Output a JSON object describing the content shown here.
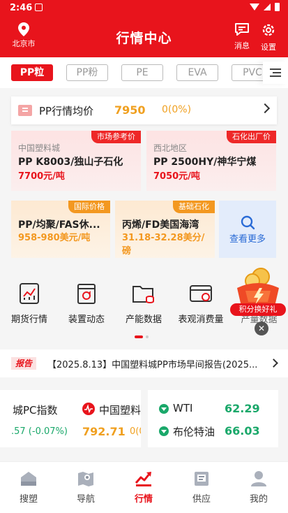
{
  "status_bar": {
    "time": "2:46"
  },
  "header": {
    "location": "北京市",
    "title": "行情中心",
    "message_label": "消息",
    "settings_label": "设置"
  },
  "tabs": [
    "PP粒",
    "PP粉",
    "PE",
    "EVA",
    "PVC"
  ],
  "active_tab": "PP粒",
  "average": {
    "title": "PP行情均价",
    "price": "7950",
    "change": "0(0%)"
  },
  "cards_top": [
    {
      "tag": "市场参考价",
      "source": "中国塑料城",
      "name": "PP K8003/独山子石化",
      "price": "7700元/吨"
    },
    {
      "tag": "石化出厂价",
      "source": "西北地区",
      "name": "PP 2500HY/神华宁煤",
      "price": "7050元/吨"
    }
  ],
  "cards_bottom": [
    {
      "tag": "国际价格",
      "name": "PP/均聚/FAS休...",
      "price": "958-980美元/吨"
    },
    {
      "tag": "基础石化",
      "name": "丙烯/FD美国海湾",
      "price_line1": "31.18-32.28美分/",
      "price_line2": "磅"
    }
  ],
  "view_more": "查看更多",
  "entries": [
    "期货行情",
    "装置动态",
    "产能数据",
    "表观消费量",
    "产量数据"
  ],
  "promo": {
    "label": "积分换好礼"
  },
  "report": {
    "badge": "报告",
    "text": "【2025.8.13】中国塑料城PP市场早间报告(2025..."
  },
  "index_left": {
    "name1": "城PC指数",
    "change1": ".57 (-0.07%)",
    "name2": "中国塑料",
    "value2": "792.71",
    "change2": "0(0"
  },
  "index_right": [
    {
      "name": "WTI",
      "value": "62.29"
    },
    {
      "name": "布伦特油",
      "value": "66.03"
    }
  ],
  "bottom_nav": [
    {
      "label": "搜塑",
      "icon": "home-icon"
    },
    {
      "label": "导航",
      "icon": "map-icon"
    },
    {
      "label": "行情",
      "icon": "chart-icon"
    },
    {
      "label": "供应",
      "icon": "supply-icon"
    },
    {
      "label": "我的",
      "icon": "user-icon"
    }
  ],
  "active_nav": "行情",
  "colors": {
    "brand": "#e8141c",
    "orange": "#f39820",
    "green": "#1aa86a",
    "blue": "#2a6bd6"
  }
}
